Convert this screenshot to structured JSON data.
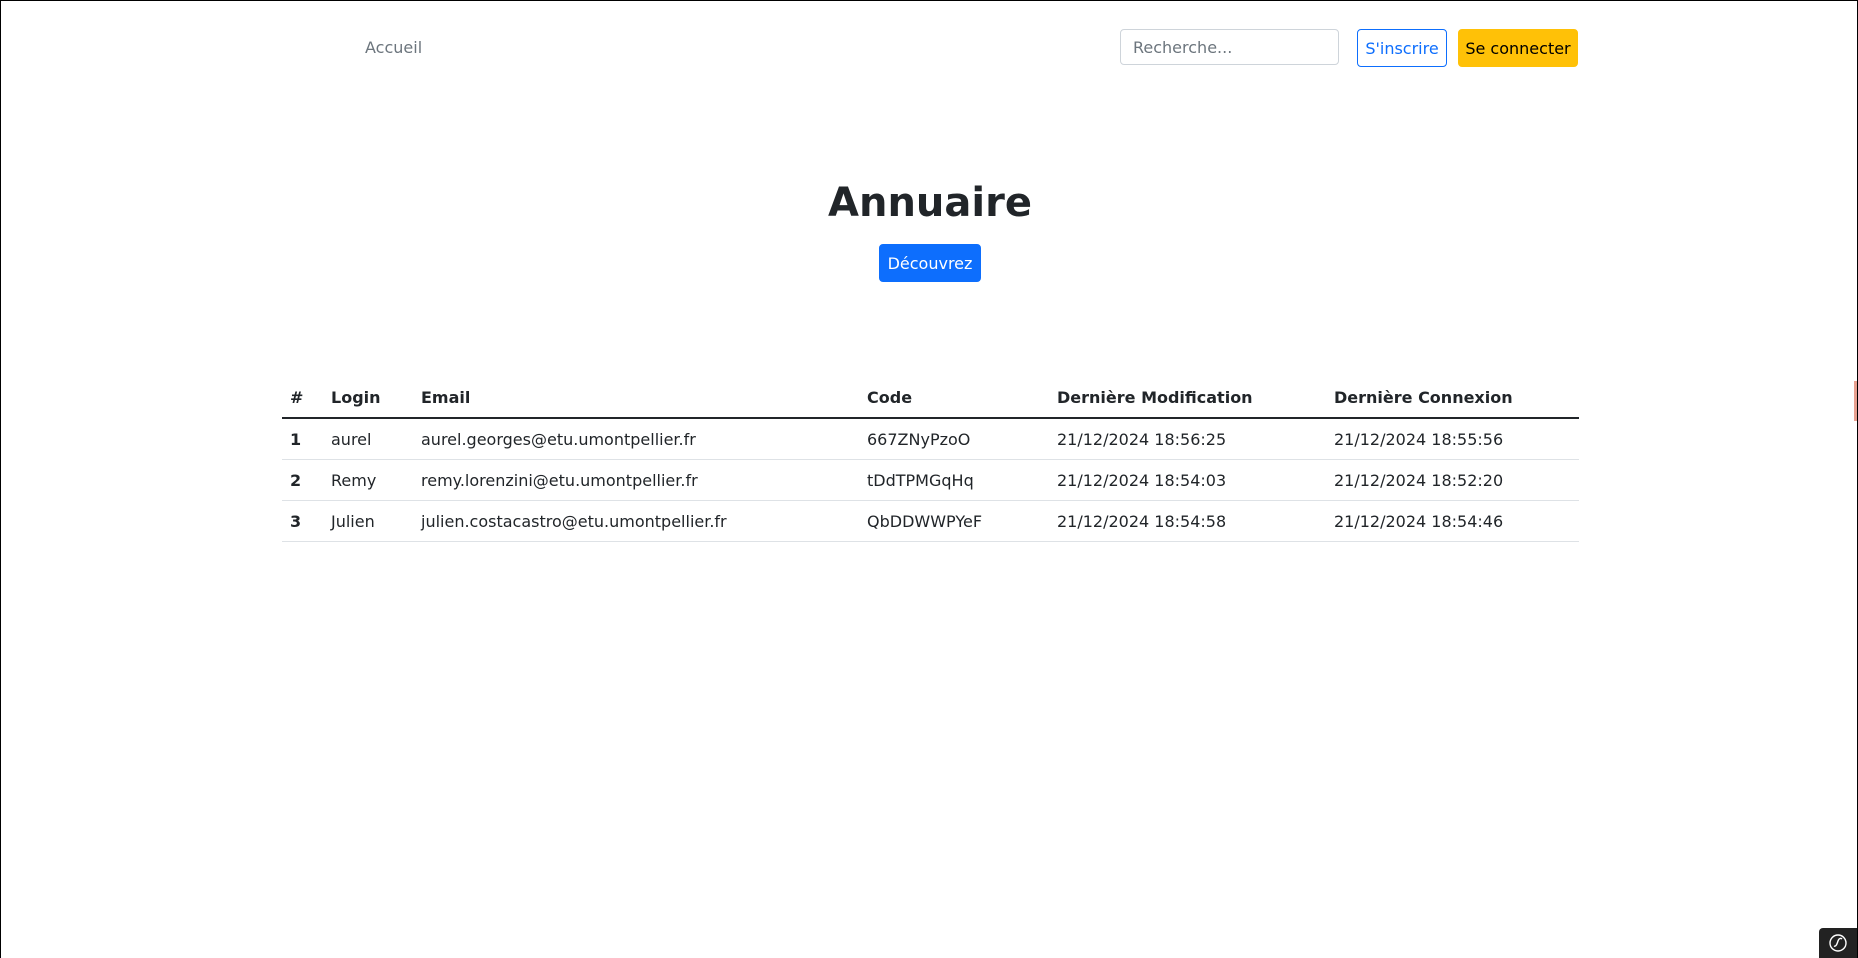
{
  "nav": {
    "home_label": "Accueil",
    "search_placeholder": "Recherche...",
    "signup_label": "S'inscrire",
    "login_label": "Se connecter"
  },
  "hero": {
    "title": "Annuaire",
    "button_label": "Découvrez"
  },
  "table": {
    "headers": [
      "#",
      "Login",
      "Email",
      "Code",
      "Dernière Modification",
      "Dernière Connexion"
    ],
    "rows": [
      [
        "1",
        "aurel",
        "aurel.georges@etu.umontpellier.fr",
        "667ZNyPzoO",
        "21/12/2024 18:56:25",
        "21/12/2024 18:55:56"
      ],
      [
        "2",
        "Remy",
        "remy.lorenzini@etu.umontpellier.fr",
        "tDdTPMGqHq",
        "21/12/2024 18:54:03",
        "21/12/2024 18:52:20"
      ],
      [
        "3",
        "Julien",
        "julien.costacastro@etu.umontpellier.fr",
        "QbDDWWPYeF",
        "21/12/2024 18:54:58",
        "21/12/2024 18:54:46"
      ]
    ]
  },
  "colors": {
    "primary": "#0d6efd",
    "warning": "#ffc107",
    "muted": "#6c757d"
  },
  "icons": {
    "debug_toolbar": "symfony-icon"
  }
}
